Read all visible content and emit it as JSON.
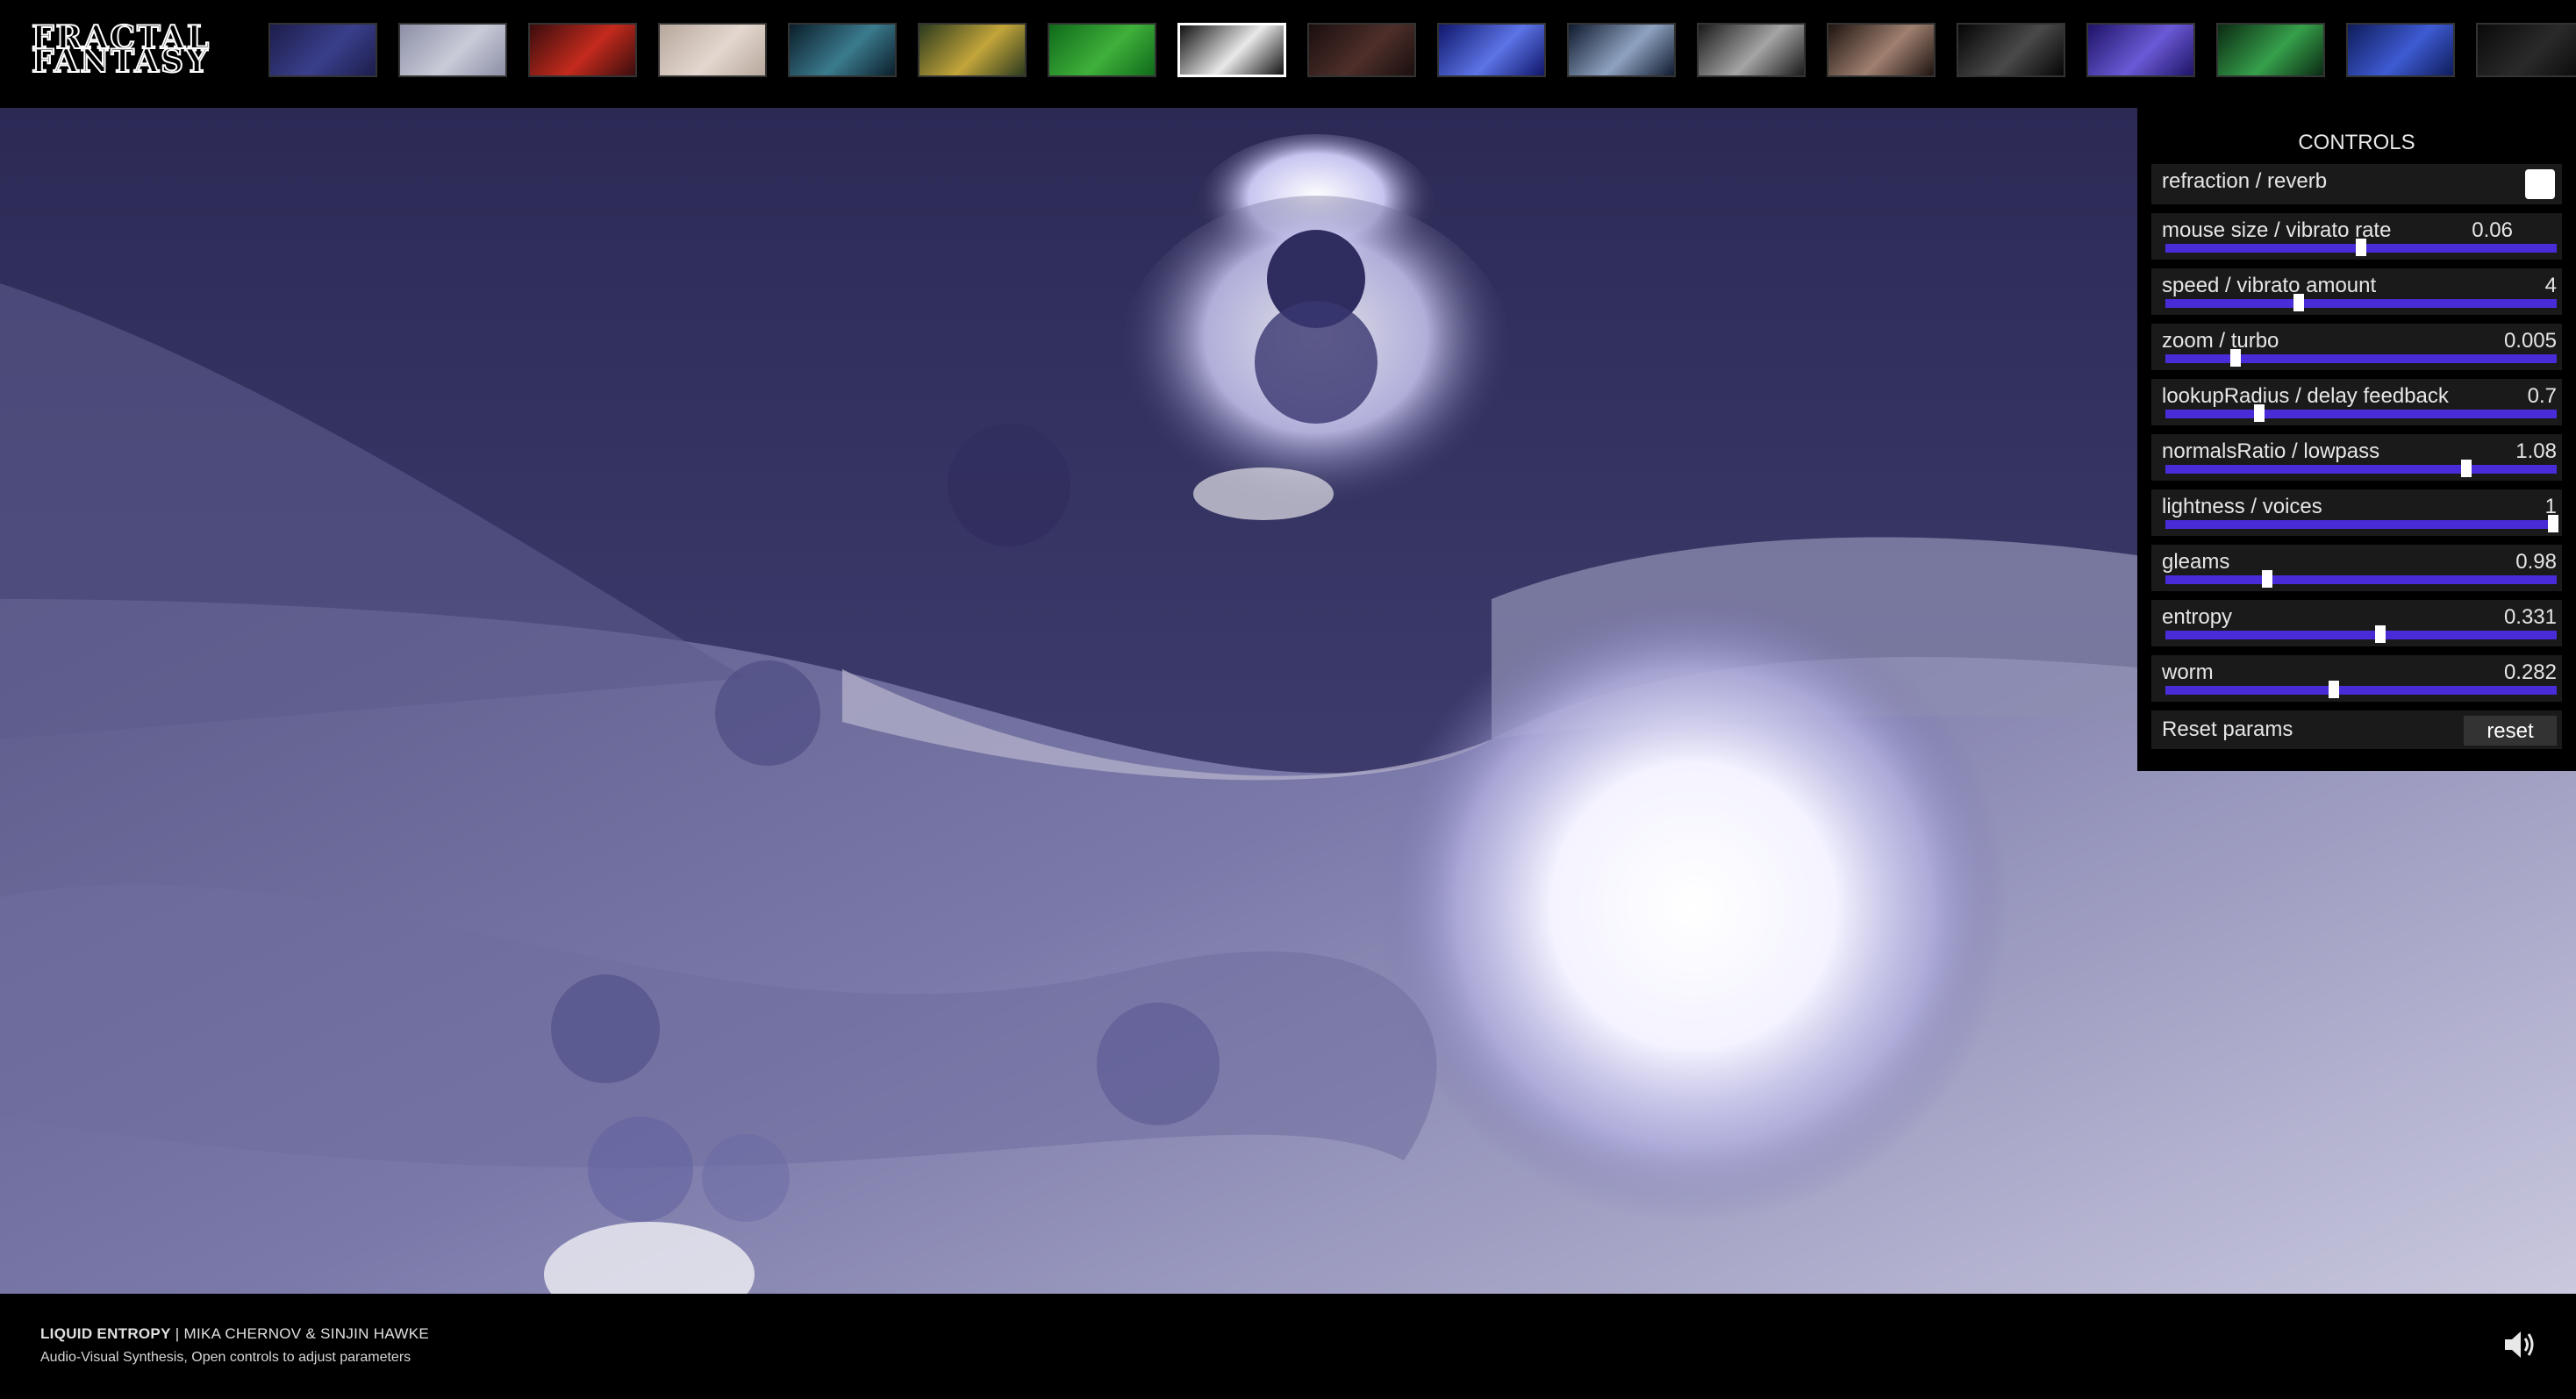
{
  "logo": {
    "line1": "FRACTAL",
    "line2": "FANTASY"
  },
  "thumbnails": [
    {
      "name": "thumb-1",
      "colors": [
        "#1c1d4a",
        "#3a3f8c"
      ]
    },
    {
      "name": "thumb-2",
      "colors": [
        "#8c8fa6",
        "#c9cbd8"
      ]
    },
    {
      "name": "thumb-3",
      "colors": [
        "#3a0d0d",
        "#c42a1d"
      ]
    },
    {
      "name": "thumb-4",
      "colors": [
        "#b7a79c",
        "#e3d7cf"
      ]
    },
    {
      "name": "thumb-5",
      "colors": [
        "#0b1e2a",
        "#3b7b8e"
      ]
    },
    {
      "name": "thumb-6",
      "colors": [
        "#2c3a1e",
        "#c2a53a"
      ]
    },
    {
      "name": "thumb-7",
      "colors": [
        "#0f6a1a",
        "#3fb03a"
      ]
    },
    {
      "name": "thumb-8",
      "colors": [
        "#111111",
        "#e9e9e9"
      ]
    },
    {
      "name": "thumb-9",
      "colors": [
        "#1a0f0e",
        "#4e2f2a"
      ]
    },
    {
      "name": "thumb-10",
      "colors": [
        "#10166b",
        "#5c74e6"
      ]
    },
    {
      "name": "thumb-11",
      "colors": [
        "#0f1a2e",
        "#8fa3c1"
      ]
    },
    {
      "name": "thumb-12",
      "colors": [
        "#1a1a1a",
        "#a5a5a5"
      ]
    },
    {
      "name": "thumb-13",
      "colors": [
        "#1e1410",
        "#a08070"
      ]
    },
    {
      "name": "thumb-14",
      "colors": [
        "#050505",
        "#4a4a4a"
      ]
    },
    {
      "name": "thumb-15",
      "colors": [
        "#1d1366",
        "#6b5ad6"
      ]
    },
    {
      "name": "thumb-16",
      "colors": [
        "#0b2a12",
        "#36a04b"
      ]
    },
    {
      "name": "thumb-17",
      "colors": [
        "#0e1c5a",
        "#3e5bd3"
      ]
    },
    {
      "name": "thumb-18",
      "colors": [
        "#0a0a0a",
        "#2a2a2a"
      ]
    }
  ],
  "active_thumbnail_index": 7,
  "controls": {
    "title": "CONTROLS",
    "toggle": {
      "label": "refraction / reverb",
      "checked": true
    },
    "sliders": [
      {
        "label": "mouse size / vibrato rate",
        "value": "0.06",
        "position": 0.5,
        "narrow": true
      },
      {
        "label": "speed / vibrato amount",
        "value": "4",
        "position": 0.34
      },
      {
        "label": "zoom / turbo",
        "value": "0.005",
        "position": 0.18
      },
      {
        "label": "lookupRadius / delay feedback",
        "value": "0.7",
        "position": 0.24
      },
      {
        "label": "normalsRatio / lowpass",
        "value": "1.08",
        "position": 0.77
      },
      {
        "label": "lightness / voices",
        "value": "1",
        "position": 0.99
      },
      {
        "label": "gleams",
        "value": "0.98",
        "position": 0.26
      },
      {
        "label": "entropy",
        "value": "0.331",
        "position": 0.55
      },
      {
        "label": "worm",
        "value": "0.282",
        "position": 0.43
      }
    ],
    "reset": {
      "label": "Reset params",
      "button": "reset"
    }
  },
  "footer": {
    "title": "LIQUID ENTROPY",
    "separator": " | ",
    "authors": "MIKA CHERNOV & SINJIN HAWKE",
    "subtitle": "Audio-Visual Synthesis, Open controls to adjust parameters"
  },
  "icons": {
    "sound": "speaker-volume-icon"
  },
  "colors": {
    "accent": "#4a2bd8",
    "background": "#000000",
    "stage": "#4b4a78"
  }
}
